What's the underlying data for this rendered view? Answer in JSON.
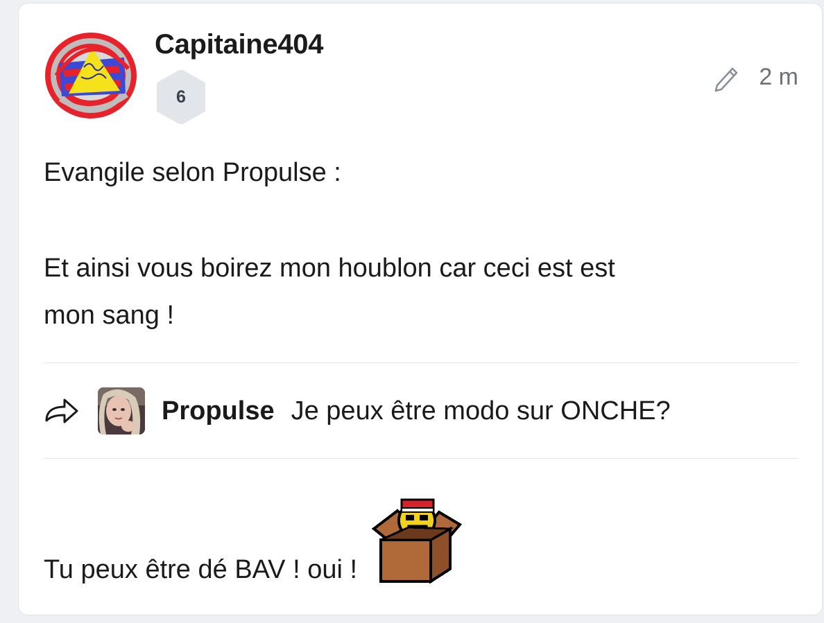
{
  "post": {
    "author": "Capitaine404",
    "level": "6",
    "time": "2 m",
    "body_lines": [
      "Evangile selon Propulse :",
      "Et ainsi vous boirez mon houblon car ceci est est",
      "mon sang !"
    ],
    "quote": {
      "author": "Propulse",
      "text": "Je peux être modo sur ONCHE?"
    },
    "reply": "Tu peux être dé BAV ! oui !"
  },
  "icons": {
    "edit": "pencil-icon",
    "quote": "share-arrow-icon",
    "sticker": "smiley-in-box-sticker"
  },
  "colors": {
    "level_badge_bg": "#e2e5ea",
    "meta_text": "#6b7079",
    "divider": "#e3e5e9"
  }
}
